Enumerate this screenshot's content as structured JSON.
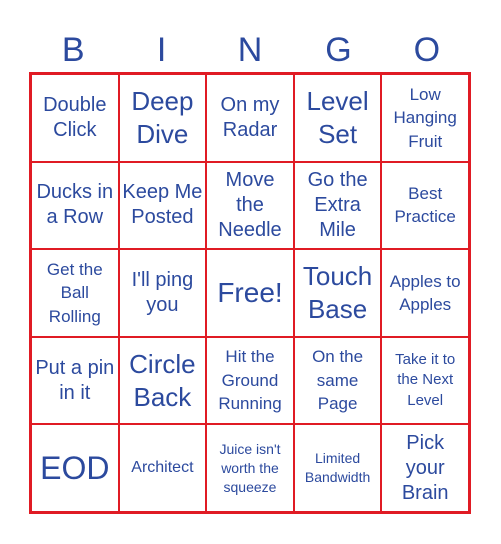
{
  "header": [
    "B",
    "I",
    "N",
    "G",
    "O"
  ],
  "colors": {
    "text": "#2c4a9e",
    "border": "#e01b24"
  },
  "cells": [
    [
      "Double Click",
      "Deep Dive",
      "On my Radar",
      "Level Set",
      "Low Hanging Fruit"
    ],
    [
      "Ducks in a Row",
      "Keep Me Posted",
      "Move the Needle",
      "Go the Extra Mile",
      "Best Practice"
    ],
    [
      "Get the Ball Rolling",
      "I'll ping you",
      "Free!",
      "Touch Base",
      "Apples to Apples"
    ],
    [
      "Put a pin in it",
      "Circle Back",
      "Hit the Ground Running",
      "On the same Page",
      "Take it to the Next Level"
    ],
    [
      "EOD",
      "Architect",
      "Juice isn't worth the squeeze",
      "Limited Bandwidth",
      "Pick your Brain"
    ]
  ]
}
